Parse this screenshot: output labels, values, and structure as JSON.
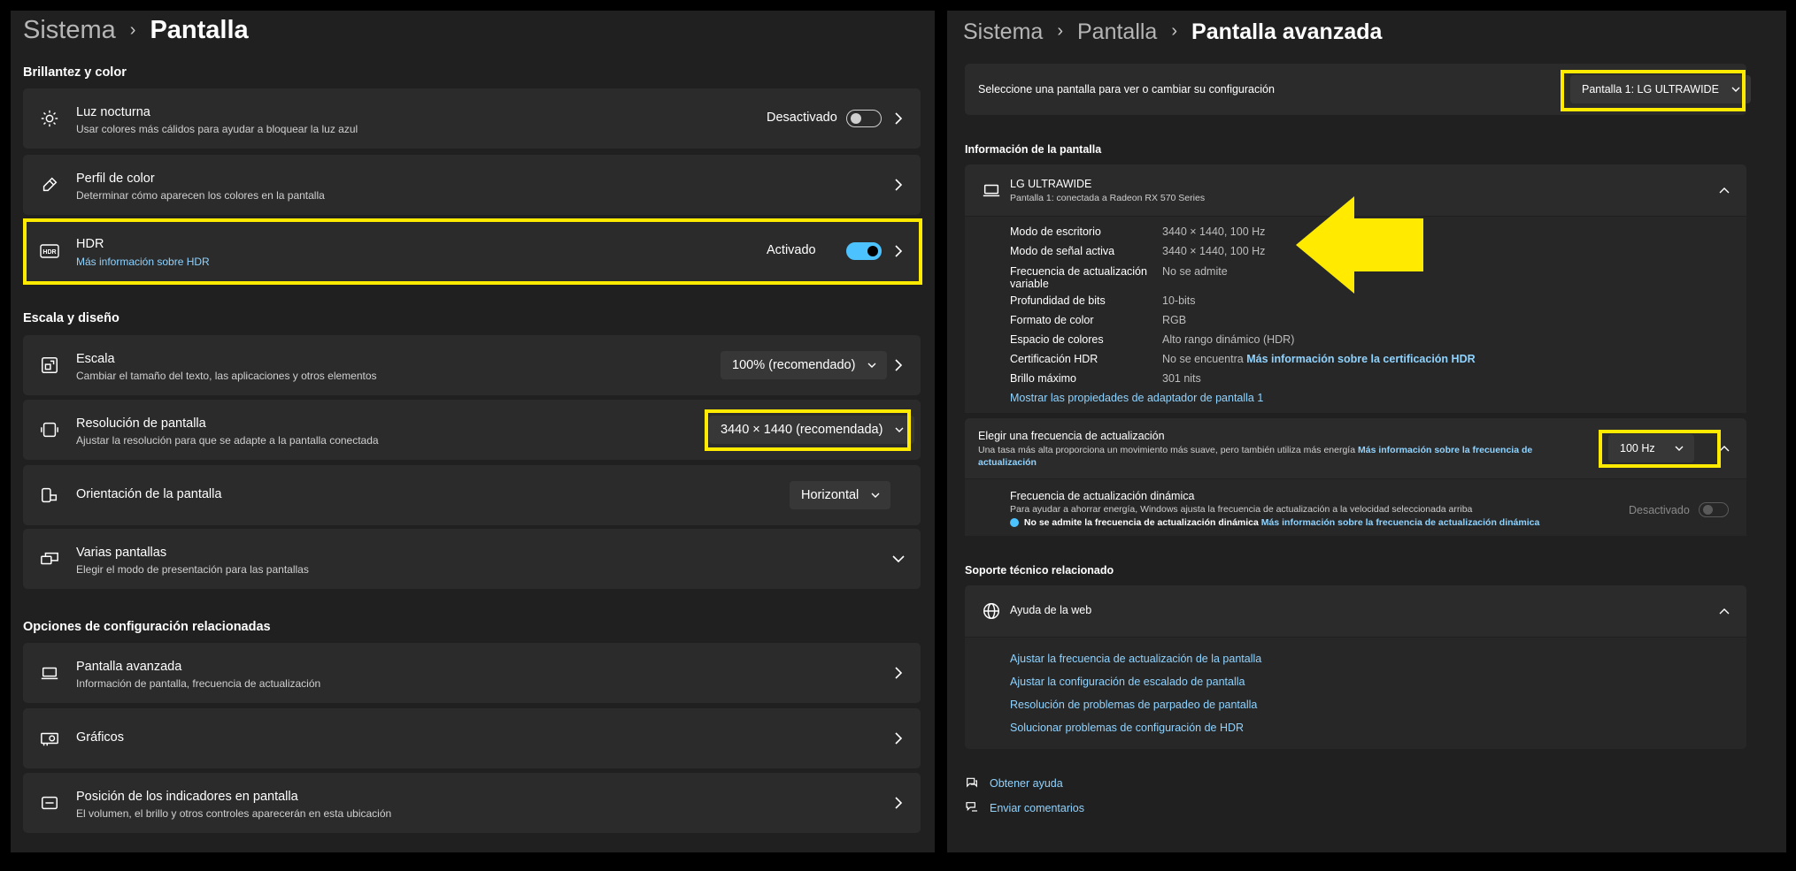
{
  "left": {
    "breadcrumb": {
      "root": "Sistema",
      "current": "Pantalla"
    },
    "sections": {
      "brightness": "Brillantez y color",
      "scale": "Escala y diseño",
      "related": "Opciones de configuración relacionadas"
    },
    "night_light": {
      "title": "Luz nocturna",
      "subtitle": "Usar colores más cálidos para ayudar a bloquear la luz azul",
      "status": "Desactivado"
    },
    "color_profile": {
      "title": "Perfil de color",
      "subtitle": "Determinar cómo aparecen los colores en la pantalla"
    },
    "hdr": {
      "title": "HDR",
      "link": "Más información sobre HDR",
      "status": "Activado"
    },
    "scale": {
      "title": "Escala",
      "subtitle": "Cambiar el tamaño del texto, las aplicaciones y otros elementos",
      "value": "100% (recomendado)"
    },
    "resolution": {
      "title": "Resolución de pantalla",
      "subtitle": "Ajustar la resolución para que se adapte a la pantalla conectada",
      "value": "3440 × 1440 (recomendada)"
    },
    "orientation": {
      "title": "Orientación de la pantalla",
      "value": "Horizontal"
    },
    "multiple": {
      "title": "Varias pantallas",
      "subtitle": "Elegir el modo de presentación para las pantallas"
    },
    "advanced": {
      "title": "Pantalla avanzada",
      "subtitle": "Información de pantalla, frecuencia de actualización"
    },
    "graphics": {
      "title": "Gráficos"
    },
    "indicators": {
      "title": "Posición de los indicadores en pantalla",
      "subtitle": "El volumen, el brillo y otros controles aparecerán en esta ubicación"
    }
  },
  "right": {
    "breadcrumb": {
      "root": "Sistema",
      "middle": "Pantalla",
      "current": "Pantalla avanzada"
    },
    "select_display": {
      "label": "Seleccione una pantalla para ver o cambiar su configuración",
      "value": "Pantalla 1: LG ULTRAWIDE"
    },
    "info_section": "Información de la pantalla",
    "monitor": {
      "name": "LG ULTRAWIDE",
      "subtitle": "Pantalla 1: conectada a Radeon RX 570 Series"
    },
    "info": [
      {
        "label": "Modo de escritorio",
        "value": "3440 × 1440, 100 Hz"
      },
      {
        "label": "Modo de señal activa",
        "value": "3440 × 1440, 100 Hz"
      },
      {
        "label": "Frecuencia de actualización",
        "label2": "variable",
        "value": "No se admite"
      },
      {
        "label": "Profundidad de bits",
        "value": "10-bits"
      },
      {
        "label": "Formato de color",
        "value": "RGB"
      },
      {
        "label": "Espacio de colores",
        "value": "Alto rango dinámico (HDR)"
      },
      {
        "label": "Certificación HDR",
        "value": "No se encuentra",
        "link": "Más información sobre la certificación HDR"
      },
      {
        "label": "Brillo máximo",
        "value": "301 nits"
      }
    ],
    "adapter_link": "Mostrar las propiedades de adaptador de pantalla 1",
    "refresh": {
      "title": "Elegir una frecuencia de actualización",
      "subtitle": "Una tasa más alta proporciona un movimiento más suave, pero también utiliza más energía",
      "link1": "Más información sobre la frecuencia de",
      "link2": "actualización",
      "value": "100 Hz"
    },
    "dynamic": {
      "title": "Frecuencia de actualización dinámica",
      "subtitle": "Para ayudar a ahorrar energía, Windows ajusta la frecuencia de actualización a la velocidad seleccionada arriba",
      "note": "No se admite la frecuencia de actualización dinámica",
      "link": "Más información sobre la frecuencia de actualización dinámica",
      "status": "Desactivado"
    },
    "support_section": "Soporte técnico relacionado",
    "web_help": "Ayuda de la web",
    "help_links": [
      "Ajustar la frecuencia de actualización de la pantalla",
      "Ajustar la configuración de escalado de pantalla",
      "Resolución de problemas de parpadeo de pantalla",
      "Solucionar problemas de configuración de HDR"
    ],
    "get_help": "Obtener ayuda",
    "feedback": "Enviar comentarios"
  },
  "colors": {
    "highlight": "#ffea00",
    "accent": "#4cc2ff",
    "link": "#8fd3ff"
  }
}
